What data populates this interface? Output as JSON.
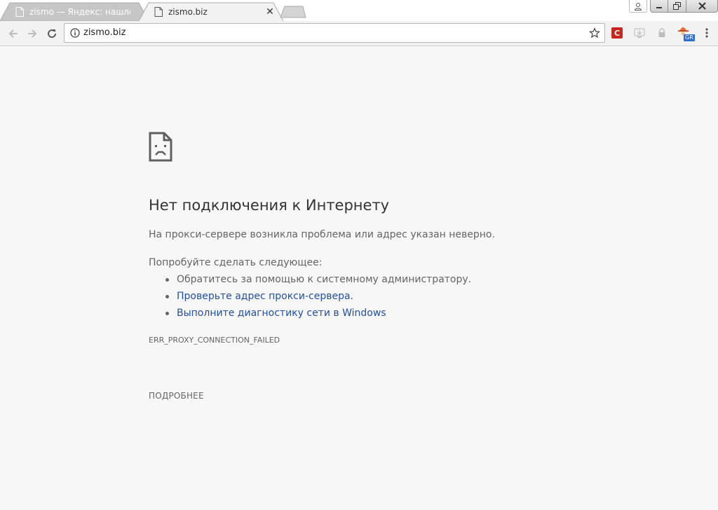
{
  "tabs": [
    {
      "title": "zismo — Яндекс: нашлос",
      "active": false
    },
    {
      "title": "zismo.biz",
      "active": true
    }
  ],
  "omnibox": {
    "url": "zismo.biz"
  },
  "extensions": {
    "c_label": "C",
    "gr_label": "GR"
  },
  "error_page": {
    "title": "Нет подключения к Интернету",
    "description": "На прокси-сервере возникла проблема или адрес указан неверно.",
    "try_heading": "Попробуйте сделать следующее:",
    "suggestions": [
      "Обратитесь за помощью к системному администратору.",
      "Проверьте адрес прокси-сервера.",
      "Выполните диагностику сети в Windows"
    ],
    "error_code": "ERR_PROXY_CONNECTION_FAILED",
    "details_label": "ПОДРОБНЕЕ"
  },
  "colors": {
    "link": "#1f4fa8",
    "text": "#646464",
    "title": "#333333",
    "page_bg": "#f7f7f7"
  }
}
